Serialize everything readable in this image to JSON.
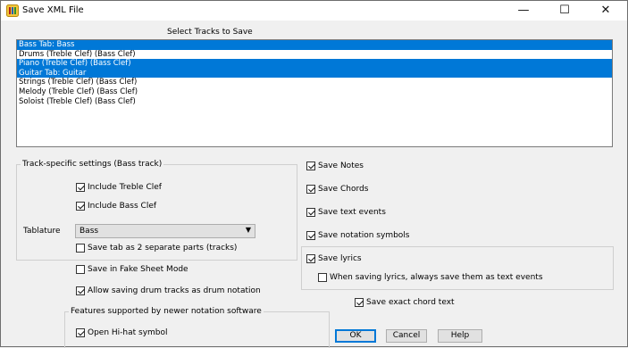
{
  "window": {
    "title": "Save XML File",
    "minimize": "—",
    "maximize": "☐",
    "close": "✕"
  },
  "tracks": {
    "heading": "Select Tracks to Save",
    "items": [
      {
        "label": "Bass Tab: Bass",
        "selected": true
      },
      {
        "label": "Drums (Treble Clef) (Bass Clef)",
        "selected": false
      },
      {
        "label": "Piano (Treble Clef) (Bass Clef)",
        "selected": true
      },
      {
        "label": "Guitar Tab: Guitar",
        "selected": true
      },
      {
        "label": "Strings (Treble Clef) (Bass Clef)",
        "selected": false
      },
      {
        "label": "Melody (Treble Clef) (Bass Clef)",
        "selected": false
      },
      {
        "label": "Soloist (Treble Clef) (Bass Clef)",
        "selected": false
      }
    ]
  },
  "track_settings": {
    "title": "Track-specific settings (Bass track)",
    "include_treble": {
      "label": "Include Treble Clef",
      "checked": true
    },
    "include_bass": {
      "label": "Include Bass Clef",
      "checked": true
    },
    "tablature_label": "Tablature",
    "tablature_value": "Bass",
    "save_tab_parts": {
      "label": "Save tab as 2 separate parts (tracks)",
      "checked": false
    }
  },
  "options": {
    "fake_sheet": {
      "label": "Save in Fake Sheet Mode",
      "checked": false
    },
    "drum_notation": {
      "label": "Allow saving drum tracks as drum notation",
      "checked": true
    }
  },
  "newer_features": {
    "title": "Features supported by newer notation software",
    "open_hihat": {
      "label": "Open Hi-hat symbol",
      "checked": true
    }
  },
  "save_options": {
    "notes": {
      "label": "Save Notes",
      "checked": true
    },
    "chords": {
      "label": "Save Chords",
      "checked": true
    },
    "text_events": {
      "label": "Save text events",
      "checked": true
    },
    "notation_symbols": {
      "label": "Save notation symbols",
      "checked": true
    },
    "lyrics": {
      "label": "Save lyrics",
      "checked": true
    },
    "lyrics_as_text": {
      "label": "When saving lyrics, always save them as text events",
      "checked": false
    },
    "exact_chord": {
      "label": "Save exact chord text",
      "checked": true
    }
  },
  "buttons": {
    "ok": "OK",
    "cancel": "Cancel",
    "help": "Help"
  }
}
